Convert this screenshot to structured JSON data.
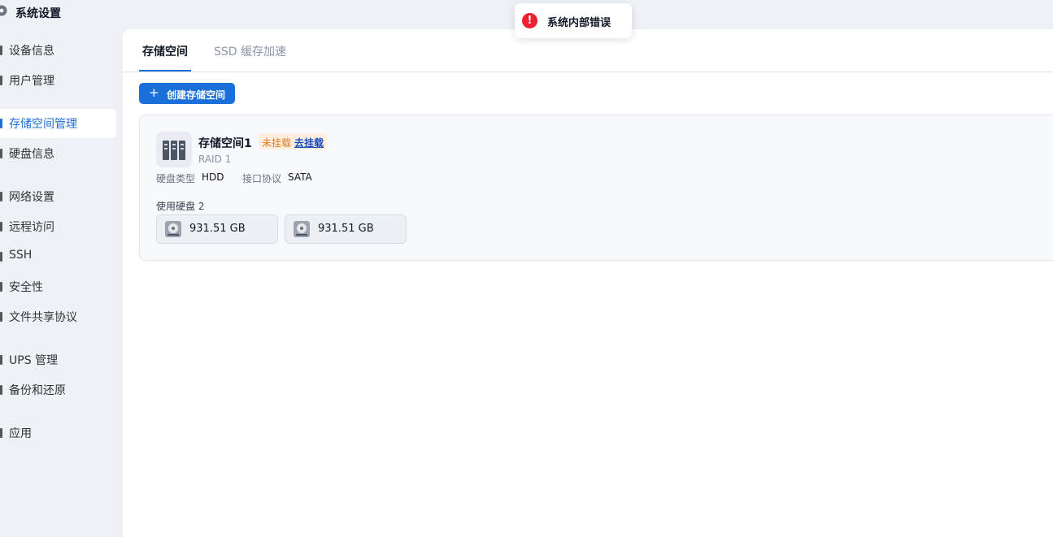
{
  "app": {
    "title": "系统设置"
  },
  "sidebar": {
    "items": [
      {
        "label": "设备信息"
      },
      {
        "label": "用户管理"
      },
      {
        "label": "存储空间管理",
        "active": true
      },
      {
        "label": "硬盘信息"
      },
      {
        "label": "网络设置"
      },
      {
        "label": "远程访问"
      },
      {
        "label": "SSH"
      },
      {
        "label": "安全性"
      },
      {
        "label": "文件共享协议"
      },
      {
        "label": "UPS 管理"
      },
      {
        "label": "备份和还原"
      },
      {
        "label": "应用"
      }
    ]
  },
  "tabs": [
    {
      "label": "存储空间",
      "active": true
    },
    {
      "label": "SSD 缓存加速"
    }
  ],
  "toolbar": {
    "create_label": "创建存储空间",
    "create_icon": "plus-icon"
  },
  "storage": {
    "name": "存储空间1",
    "status": "未挂载",
    "action": "去挂载",
    "raid": "RAID 1",
    "disk_type_label": "硬盘类型",
    "disk_type": "HDD",
    "interface_label": "接口协议",
    "interface": "SATA",
    "disks_label": "使用硬盘 2",
    "disks": [
      {
        "size": "931.51 GB"
      },
      {
        "size": "931.51 GB"
      }
    ]
  },
  "toast": {
    "message": "系统内部错误",
    "icon": "!"
  },
  "colors": {
    "accent": "#1a6fd8",
    "warning": "#e07b22",
    "error": "#f0202f"
  }
}
